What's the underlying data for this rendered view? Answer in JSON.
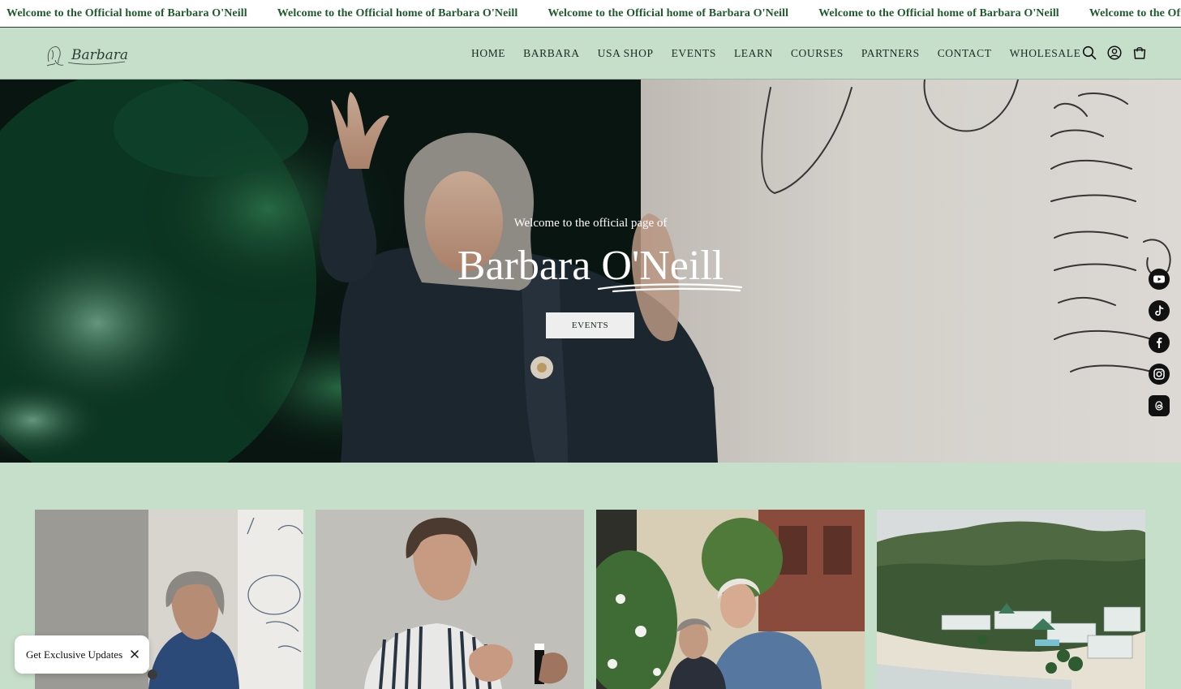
{
  "announcement": {
    "messages": [
      "Welcome to the Official home of Barbara O'Neill",
      "Welcome to the Official home of Barbara O'Neill",
      "Welcome to the Official home of Barbara O'Neill",
      "Welcome to the Official home of Barbara O'Neill",
      "Welcome to the Official home of Barbara O'Neill"
    ]
  },
  "header": {
    "logo_text": "Barbara",
    "nav": [
      "HOME",
      "BARBARA",
      "USA SHOP",
      "EVENTS",
      "LEARN",
      "COURSES",
      "PARTNERS",
      "CONTACT",
      "WHOLESALE"
    ],
    "icons": [
      "search-icon",
      "account-icon",
      "cart-icon"
    ]
  },
  "hero": {
    "kicker": "Welcome to the official page of",
    "title": "Barbara O'Neill",
    "button_label": "EVENTS"
  },
  "social": [
    "youtube-icon",
    "tiktok-icon",
    "facebook-icon",
    "instagram-icon",
    "threads-icon"
  ],
  "gallery": [
    "gallery-photo-barbara-whiteboard",
    "gallery-photo-barbara-speaking",
    "gallery-photo-barbara-couple",
    "gallery-photo-resort-aerial"
  ],
  "popup": {
    "label": "Get Exclusive Updates"
  },
  "colors": {
    "background": "#c6dfca",
    "announcement_text": "#1f5a2d",
    "nav_text": "#1c2a21"
  }
}
